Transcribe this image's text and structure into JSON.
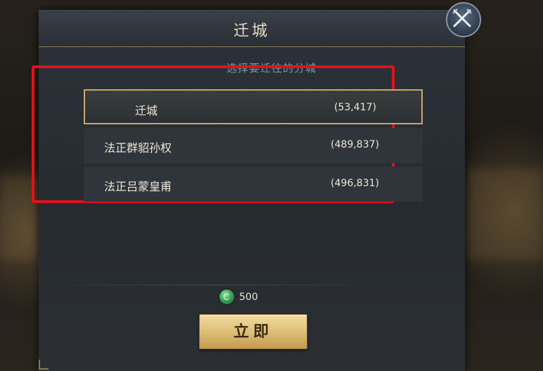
{
  "dialog": {
    "title": "迁城",
    "subtitle": "选择要迁往的分城",
    "options": [
      {
        "name": "迁城",
        "coords": "(53,417)",
        "selected": true
      },
      {
        "name": "法正群貂孙权",
        "coords": "(489,837)",
        "selected": false
      },
      {
        "name": "法正吕蒙皇甫",
        "coords": "(496,831)",
        "selected": false
      }
    ],
    "cost": {
      "icon": "jade-currency-icon",
      "value": "500"
    },
    "confirm_label": "立即",
    "close_icon": "crossed-swords-close-icon"
  },
  "colors": {
    "highlight_frame": "#e0111c",
    "selected_border": "#c8a86a",
    "subtitle_text": "#6fa0a0",
    "button_gold": "#dcbc74"
  }
}
